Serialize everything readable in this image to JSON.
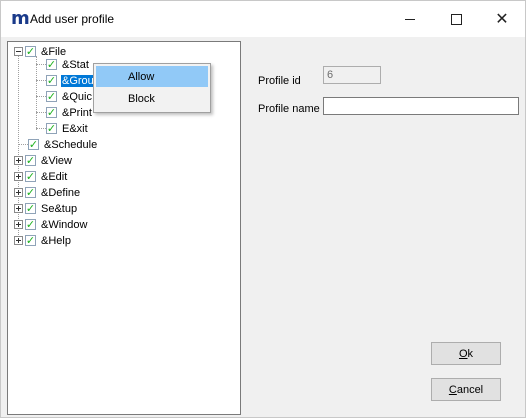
{
  "window": {
    "logo": "m",
    "title": "Add  user profile"
  },
  "tree": {
    "items": [
      {
        "label": "&File"
      },
      {
        "label": "&Stat"
      },
      {
        "label": "&Grou"
      },
      {
        "label": "&Quic"
      },
      {
        "label": "&Print"
      },
      {
        "label": "E&xit"
      },
      {
        "label": "&Schedule"
      },
      {
        "label": "&View"
      },
      {
        "label": "&Edit"
      },
      {
        "label": "&Define"
      },
      {
        "label": "Se&tup"
      },
      {
        "label": "&Window"
      },
      {
        "label": "&Help"
      }
    ]
  },
  "context_menu": {
    "items": [
      {
        "label": "Allow"
      },
      {
        "label": "Block"
      }
    ]
  },
  "form": {
    "profile_id_label": "Profile id",
    "profile_id_value": "6",
    "profile_name_label": "Profile name",
    "profile_name_value": "",
    "ok_prefix": "",
    "ok_mnemonic": "O",
    "ok_rest": "k",
    "cancel_prefix": "",
    "cancel_mnemonic": "C",
    "cancel_rest": "ancel"
  }
}
